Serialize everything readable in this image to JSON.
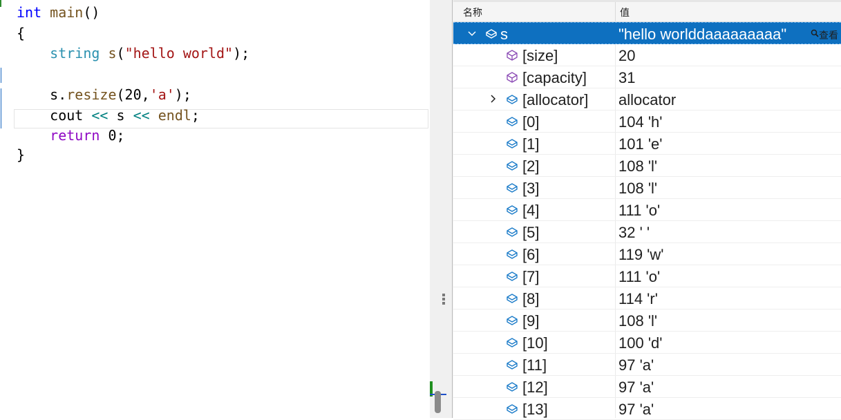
{
  "editor": {
    "lines": [
      {
        "tokens": [
          {
            "t": "int",
            "c": "kw"
          },
          {
            "t": " "
          },
          {
            "t": "main",
            "c": "fn"
          },
          {
            "t": "()"
          }
        ]
      },
      {
        "tokens": [
          {
            "t": "{"
          }
        ]
      },
      {
        "tokens": [
          {
            "t": "    "
          },
          {
            "t": "string",
            "c": "type"
          },
          {
            "t": " "
          },
          {
            "t": "s",
            "c": "fn"
          },
          {
            "t": "("
          },
          {
            "t": "\"hello world\"",
            "c": "str"
          },
          {
            "t": ");"
          }
        ]
      },
      {
        "tokens": [
          {
            "t": ""
          }
        ]
      },
      {
        "tokens": [
          {
            "t": "    s."
          },
          {
            "t": "resize",
            "c": "fn"
          },
          {
            "t": "(20,"
          },
          {
            "t": "'a'",
            "c": "str"
          },
          {
            "t": ");"
          }
        ]
      },
      {
        "tokens": [
          {
            "t": "    cout "
          },
          {
            "t": "<<",
            "c": "op"
          },
          {
            "t": " s "
          },
          {
            "t": "<<",
            "c": "op"
          },
          {
            "t": " "
          },
          {
            "t": "endl",
            "c": "fn"
          },
          {
            "t": ";"
          }
        ]
      },
      {
        "tokens": [
          {
            "t": "    "
          },
          {
            "t": "return",
            "c": "kw2"
          },
          {
            "t": " 0;"
          }
        ]
      },
      {
        "tokens": [
          {
            "t": "}"
          }
        ]
      }
    ]
  },
  "watch": {
    "header": {
      "name": "名称",
      "value": "值"
    },
    "selected_row": {
      "name": "s",
      "value": "\"hello worlddaaaaaaaaa\"",
      "viewer_label": "查看"
    },
    "rows": [
      {
        "name": "[size]",
        "value": "20",
        "icon": "property-icon",
        "expandable": false
      },
      {
        "name": "[capacity]",
        "value": "31",
        "icon": "property-icon",
        "expandable": false
      },
      {
        "name": "[allocator]",
        "value": "allocator",
        "icon": "field-icon",
        "expandable": true
      },
      {
        "name": "[0]",
        "value": "104 'h'",
        "icon": "field-icon",
        "expandable": false
      },
      {
        "name": "[1]",
        "value": "101 'e'",
        "icon": "field-icon",
        "expandable": false
      },
      {
        "name": "[2]",
        "value": "108 'l'",
        "icon": "field-icon",
        "expandable": false
      },
      {
        "name": "[3]",
        "value": "108 'l'",
        "icon": "field-icon",
        "expandable": false
      },
      {
        "name": "[4]",
        "value": "111 'o'",
        "icon": "field-icon",
        "expandable": false
      },
      {
        "name": "[5]",
        "value": "32 ' '",
        "icon": "field-icon",
        "expandable": false
      },
      {
        "name": "[6]",
        "value": "119 'w'",
        "icon": "field-icon",
        "expandable": false
      },
      {
        "name": "[7]",
        "value": "111 'o'",
        "icon": "field-icon",
        "expandable": false
      },
      {
        "name": "[8]",
        "value": "114 'r'",
        "icon": "field-icon",
        "expandable": false
      },
      {
        "name": "[9]",
        "value": "108 'l'",
        "icon": "field-icon",
        "expandable": false
      },
      {
        "name": "[10]",
        "value": "100 'd'",
        "icon": "field-icon",
        "expandable": false
      },
      {
        "name": "[11]",
        "value": "97 'a'",
        "icon": "field-icon",
        "expandable": false
      },
      {
        "name": "[12]",
        "value": "97 'a'",
        "icon": "field-icon",
        "expandable": false
      },
      {
        "name": "[13]",
        "value": "97 'a'",
        "icon": "field-icon",
        "expandable": false
      }
    ]
  },
  "colors": {
    "selection": "#0e70c0",
    "keyword": "#0000ff",
    "type": "#2b91af",
    "string": "#a31515",
    "function": "#74531f",
    "return_keyword": "#8f08c4"
  }
}
